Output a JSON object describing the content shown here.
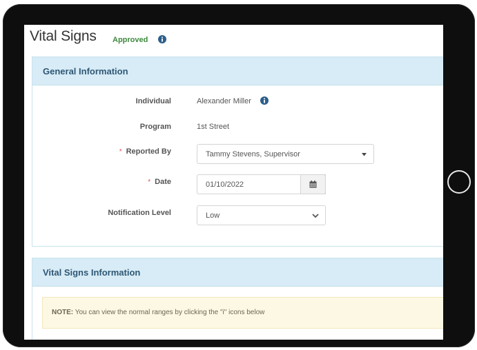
{
  "page": {
    "title": "Vital Signs",
    "status": "Approved"
  },
  "general": {
    "heading": "General Information",
    "individual_label": "Individual",
    "individual_value": "Alexander Miller",
    "program_label": "Program",
    "program_value": "1st Street",
    "reported_by_label": "Reported By",
    "reported_by_value": "Tammy Stevens, Supervisor",
    "date_label": "Date",
    "date_value": "01/10/2022",
    "notification_label": "Notification Level",
    "notification_value": "Low",
    "required_marker": "*"
  },
  "vital": {
    "heading": "Vital Signs Information",
    "note_prefix": "NOTE:",
    "note_text": " You can view the normal ranges by clicking the \"i\" icons below"
  },
  "colors": {
    "panel_heading_bg": "#d7ecf6",
    "panel_title": "#2f5775",
    "approved": "#3c8a3c",
    "info_icon": "#2d5f8a",
    "required": "#d9534f",
    "note_bg": "#fcf8e3"
  },
  "icons": {
    "status_info": "info-circle-icon",
    "individual_info": "info-circle-icon",
    "reported_by_dropdown": "caret-down-icon",
    "date_picker": "calendar-icon",
    "notification_dropdown": "chevron-down-icon",
    "home_button": "circle"
  }
}
